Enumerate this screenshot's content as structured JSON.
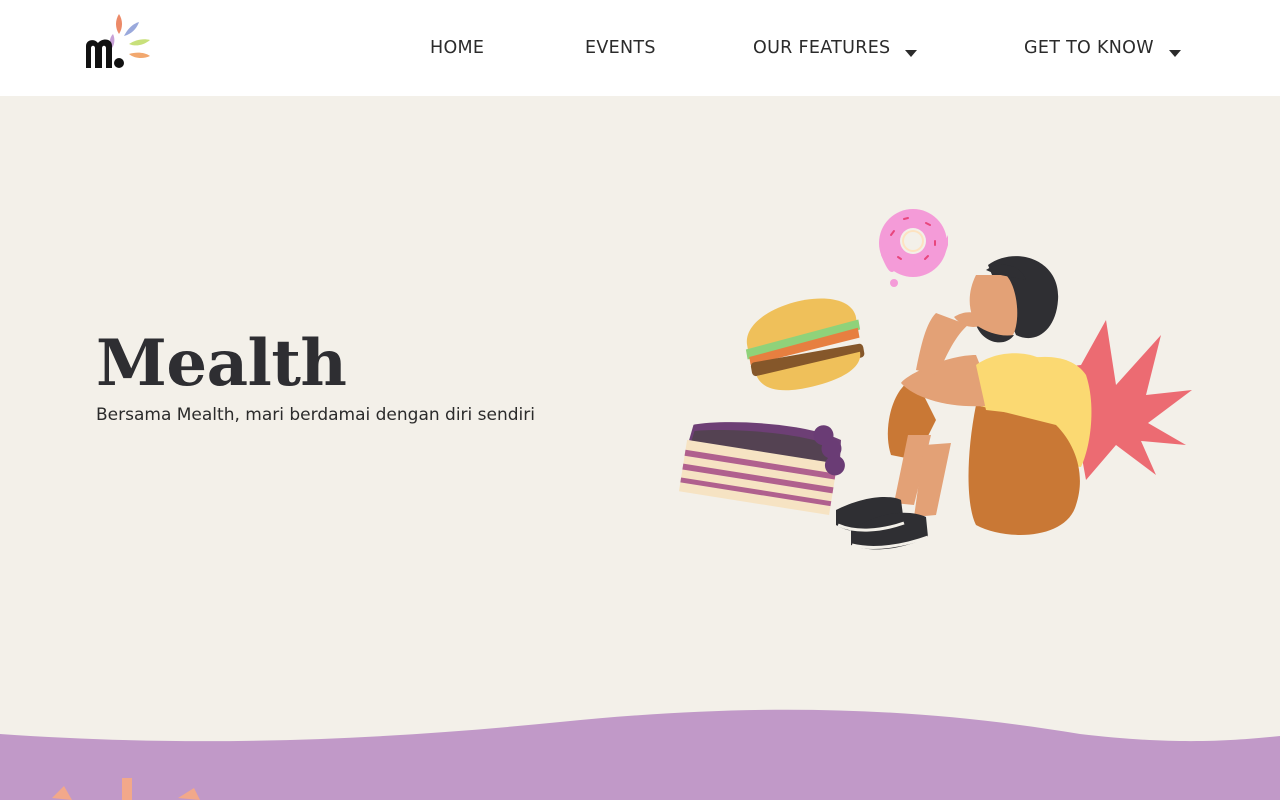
{
  "nav": {
    "logo_icon": "mealth-logo-icon",
    "items": [
      {
        "label": "HOME",
        "has_dropdown": false
      },
      {
        "label": "EVENTS",
        "has_dropdown": false
      },
      {
        "label": "OUR FEATURES",
        "has_dropdown": true
      },
      {
        "label": "GET TO KNOW",
        "has_dropdown": true
      }
    ]
  },
  "hero": {
    "title": "Mealth",
    "subtitle": "Bersama Mealth, mari berdamai dengan diri sendiri",
    "illustration_icon": "person-craving-food-illustration"
  },
  "colors": {
    "page_background": "#f3f0e9",
    "navbar_background": "#ffffff",
    "wave": "#c199c8",
    "accent_star": "#ec6b72"
  }
}
